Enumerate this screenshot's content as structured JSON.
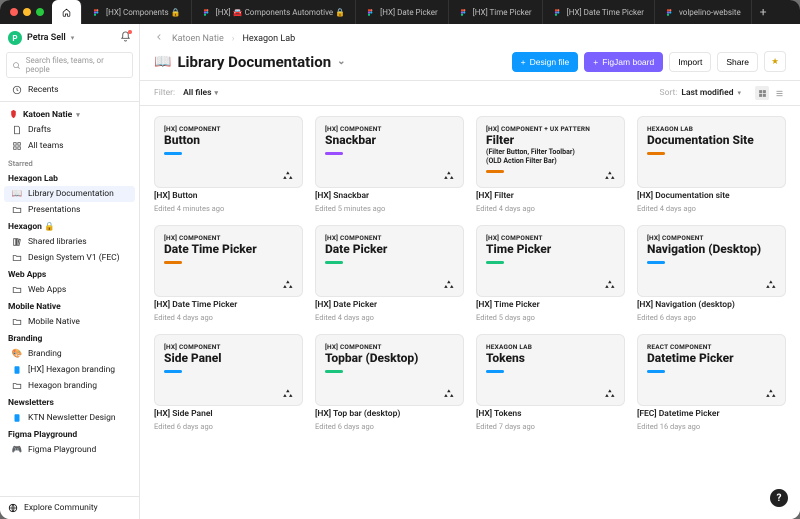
{
  "tabs": [
    {
      "label": "",
      "icon": "home",
      "active": true
    },
    {
      "label": "[HX] Components 🔒",
      "icon": "figma"
    },
    {
      "label": "[HX] 🚘 Components Automotive 🔒",
      "icon": "figma"
    },
    {
      "label": "[HX] Date Picker",
      "icon": "figma"
    },
    {
      "label": "[HX] Time Picker",
      "icon": "figma"
    },
    {
      "label": "[HX] Date Time Picker",
      "icon": "figma"
    },
    {
      "label": "volpelino-website",
      "icon": "figma"
    }
  ],
  "user": {
    "initial": "P",
    "name": "Petra Sell"
  },
  "search_placeholder": "Search files, teams, or people",
  "sidebar": {
    "recents": "Recents",
    "katoen": "Katoen Natie",
    "drafts": "Drafts",
    "all_teams": "All teams",
    "sections": {
      "starred": "Starred",
      "hexagon_lab": "Hexagon Lab",
      "hexagon_lock": "Hexagon 🔒",
      "web_apps": "Web Apps",
      "mobile_native": "Mobile Native",
      "branding": "Branding",
      "newsletters": "Newsletters",
      "figma_playground": "Figma Playground"
    },
    "items": {
      "library_doc": "Library Documentation",
      "presentations": "Presentations",
      "shared_libraries": "Shared libraries",
      "design_system_v1": "Design System V1 (FEC)",
      "web_apps": "Web Apps",
      "mobile_native": "Mobile Native",
      "branding": "Branding",
      "hx_hexagon_branding": "[HX] Hexagon branding",
      "hexagon_branding": "Hexagon branding",
      "ktn_newsletter": "KTN Newsletter Design",
      "figma_playground": "Figma Playground"
    },
    "explore": "Explore Community"
  },
  "breadcrumbs": [
    "Katoen Natie",
    "Hexagon Lab"
  ],
  "page": {
    "title": "Library Documentation",
    "folder_icon": "📖"
  },
  "actions": {
    "design": "Design file",
    "figjam": "FigJam board",
    "import": "Import",
    "share": "Share"
  },
  "filterbar": {
    "filter_label": "Filter:",
    "all_files": "All files",
    "sort_label": "Sort:",
    "sort_value": "Last modified"
  },
  "cards": [
    {
      "eyebrow": "[HX] COMPONENT",
      "cov": "Button",
      "chip": "blue",
      "name": "[HX] Button",
      "sub": "Edited 4 minutes ago"
    },
    {
      "eyebrow": "[HX] COMPONENT",
      "cov": "Snackbar",
      "chip": "purple",
      "name": "[HX] Snackbar",
      "sub": "Edited 5 minutes ago"
    },
    {
      "eyebrow": "[HX] COMPONENT + UX PATTERN",
      "cov": "Filter",
      "extra": "(Filter Button, Filter Toolbar)\n(OLD Action Filter Bar)",
      "chip": "orange",
      "name": "[HX] Filter",
      "sub": "Edited 4 days ago"
    },
    {
      "eyebrow": "HEXAGON LAB",
      "cov": "Documentation Site",
      "chip": "orange",
      "name": "[HX] Documentation site",
      "sub": "Edited 4 days ago",
      "no_corner": true
    },
    {
      "eyebrow": "[HX] COMPONENT",
      "cov": "Date Time Picker",
      "chip": "orange",
      "name": "[HX] Date Time Picker",
      "sub": "Edited 4 days ago"
    },
    {
      "eyebrow": "[HX] COMPONENT",
      "cov": "Date Picker",
      "chip": "green",
      "name": "[HX] Date Picker",
      "sub": "Edited 4 days ago"
    },
    {
      "eyebrow": "[HX] COMPONENT",
      "cov": "Time Picker",
      "chip": "green",
      "name": "[HX] Time Picker",
      "sub": "Edited 5 days ago"
    },
    {
      "eyebrow": "[HX] COMPONENT",
      "cov": "Navigation (Desktop)",
      "chip": "blue",
      "name": "[HX] Navigation (desktop)",
      "sub": "Edited 6 days ago"
    },
    {
      "eyebrow": "[HX] COMPONENT",
      "cov": "Side Panel",
      "chip": "blue",
      "name": "[HX] Side Panel",
      "sub": "Edited 6 days ago"
    },
    {
      "eyebrow": "[HX] COMPONENT",
      "cov": "Topbar (Desktop)",
      "chip": "green",
      "name": "[HX] Top bar (desktop)",
      "sub": "Edited 6 days ago"
    },
    {
      "eyebrow": "HEXAGON LAB",
      "cov": "Tokens",
      "chip": "blue",
      "name": "[HX] Tokens",
      "sub": "Edited 7 days ago"
    },
    {
      "eyebrow": "REACT COMPONENT",
      "cov": "Datetime Picker",
      "chip": "blue",
      "name": "[FEC] Datetime Picker",
      "sub": "Edited 16 days ago"
    }
  ],
  "help_label": "?"
}
